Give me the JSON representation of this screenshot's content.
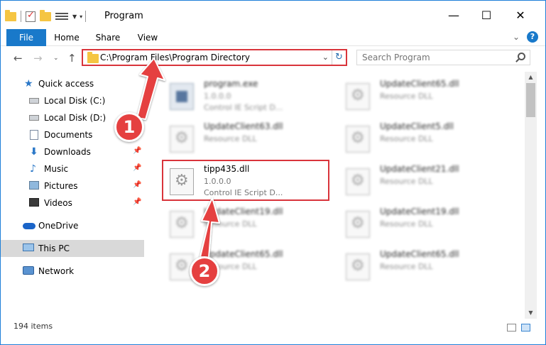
{
  "window": {
    "title": "Program"
  },
  "ribbon": {
    "tabs": [
      "File",
      "Home",
      "Share",
      "View"
    ]
  },
  "address": {
    "path": "C:\\Program Files\\Program Directory",
    "search_placeholder": "Search Program"
  },
  "sidebar": {
    "items": [
      {
        "label": "Quick access",
        "icon": "star-icon",
        "pinned": false
      },
      {
        "label": "Local Disk (C:)",
        "icon": "disk-icon",
        "pinned": false
      },
      {
        "label": "Local Disk (D:)",
        "icon": "disk-icon",
        "pinned": false
      },
      {
        "label": "Documents",
        "icon": "documents-icon",
        "pinned": false
      },
      {
        "label": "Downloads",
        "icon": "download-icon",
        "pinned": true
      },
      {
        "label": "Music",
        "icon": "music-icon",
        "pinned": true
      },
      {
        "label": "Pictures",
        "icon": "pictures-icon",
        "pinned": true
      },
      {
        "label": "Videos",
        "icon": "videos-icon",
        "pinned": true
      },
      {
        "label": "OneDrive",
        "icon": "cloud-icon",
        "pinned": false
      },
      {
        "label": "This PC",
        "icon": "computer-icon",
        "pinned": false,
        "selected": true
      },
      {
        "label": "Network",
        "icon": "network-icon",
        "pinned": false
      }
    ]
  },
  "files": [
    {
      "name": "program.exe",
      "line2": "1.0.0.0",
      "line3": "Control IE Script D...",
      "icon": "exe-icon"
    },
    {
      "name": "UpdateClient65.dll",
      "line2": "Resource DLL",
      "line3": "",
      "icon": "dll-icon"
    },
    {
      "name": "UpdateClient63.dll",
      "line2": "Resource DLL",
      "line3": "",
      "icon": "dll-icon"
    },
    {
      "name": "UpdateClient5.dll",
      "line2": "Resource DLL",
      "line3": "",
      "icon": "dll-icon"
    },
    {
      "name": "tipp435.dll",
      "line2": "1.0.0.0",
      "line3": "Control IE Script D...",
      "icon": "dll-icon",
      "highlighted": true
    },
    {
      "name": "UpdateClient21.dll",
      "line2": "Resource DLL",
      "line3": "",
      "icon": "dll-icon"
    },
    {
      "name": "UpdateClient19.dll",
      "line2": "Resource DLL",
      "line3": "",
      "icon": "dll-icon"
    },
    {
      "name": "UpdateClient19.dll",
      "line2": "Resource DLL",
      "line3": "",
      "icon": "dll-icon"
    },
    {
      "name": "UpdateClient65.dll",
      "line2": "Resource DLL",
      "line3": "",
      "icon": "dll-icon"
    },
    {
      "name": "UpdateClient65.dll",
      "line2": "Resource DLL",
      "line3": "",
      "icon": "dll-icon"
    }
  ],
  "status": {
    "item_count": "194 items"
  },
  "annotations": {
    "step1": "1",
    "step2": "2",
    "color": "#e54040"
  }
}
